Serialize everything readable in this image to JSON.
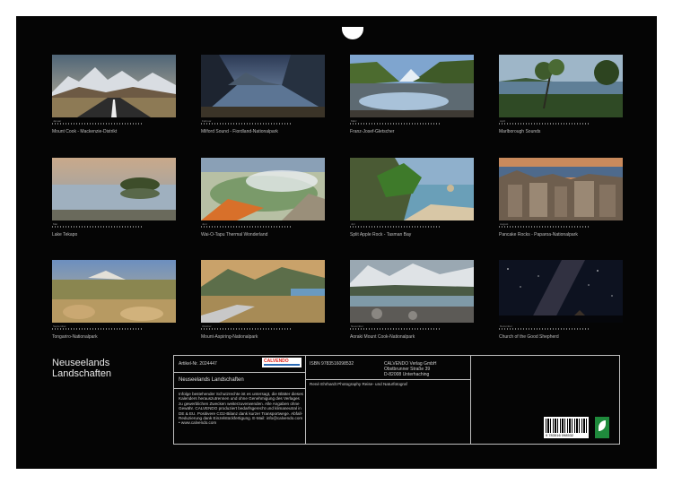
{
  "calendar": {
    "title_line1": "Neuseelands",
    "title_line2": "Landschaften",
    "months": [
      {
        "month": "Januar",
        "caption": "Mount Cook - Mackenzie-Distrikt",
        "theme": "road to snowy peaks"
      },
      {
        "month": "Februar",
        "caption": "Milford Sound - Fiordland-Nationalpark",
        "theme": "fjord reflection"
      },
      {
        "month": "März",
        "caption": "Franz-Josef-Gletscher",
        "theme": "glacier valley"
      },
      {
        "month": "April",
        "caption": "Marlborough Sounds",
        "theme": "coast with tree"
      },
      {
        "month": "Mai",
        "caption": "Lake Tekapo",
        "theme": "lake with island"
      },
      {
        "month": "Juni",
        "caption": "Wai-O-Tapu Thermal Wonderland",
        "theme": "thermal pool"
      },
      {
        "month": "Juli",
        "caption": "Split Apple Rock - Tasman Bay",
        "theme": "coast rocks"
      },
      {
        "month": "August",
        "caption": "Pancake Rocks - Paparoa-Nationalpark",
        "theme": "layered rocks"
      },
      {
        "month": "September",
        "caption": "Tongariro-Nationalpark",
        "theme": "tussock plains"
      },
      {
        "month": "Oktober",
        "caption": "Mount-Aspiring-Nationalpark",
        "theme": "mountain road"
      },
      {
        "month": "November",
        "caption": "Aoraki Mount Cook-Nationalpark",
        "theme": "glacial lake"
      },
      {
        "month": "Dezember",
        "caption": "Church of the Good Shepherd",
        "theme": "milky way"
      }
    ]
  },
  "info": {
    "article_label": "Artikel-Nr. 2024447",
    "product_title": "Neuseelands Landschaften",
    "isbn": "ISBN 9783516098532",
    "publisher_lines": [
      "CALVENDO Verlag GmbH",
      "Obstbrunner Straße 39",
      "D-82008 Unterhaching"
    ],
    "author": "René Ehrhardt Photography Reise- und Naturfotograf",
    "description": "Infolge bestehender Schutzrechte ist es untersagt, die Blätter dieses Kalenders herauszutrennen und ohne Genehmigung des Verlages zu gewerblichen Zwecken weiterzuverwenden. Alle Angaben ohne Gewähr. CALVENDO produziert bedarfsgerecht und klimaneutral in DE & EU. Positivere CO2-Bilanz dank kurzer Transportwege. Abfall-Reduzierung dank Einzelstückfertigung. E-Mail: info@calvendo.com • www.calvendo.com",
    "logo_text": "CALVENDO",
    "barcode_number": "9 783516 098532"
  }
}
